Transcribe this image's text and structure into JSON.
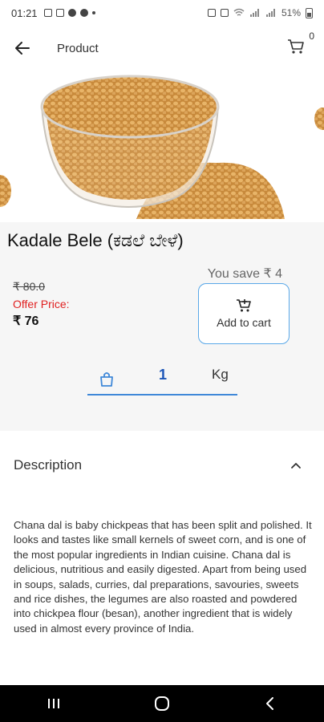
{
  "status_bar": {
    "time": "01:21",
    "battery": "51%"
  },
  "app_bar": {
    "title": "Product",
    "cart_count": "0"
  },
  "product": {
    "name": "Kadale Bele (ಕಡಲೆ ಬೇಳೆ)",
    "mrp": "₹ 80.0",
    "offer_label": "Offer Price:",
    "offer_price": "₹ 76",
    "you_save": "You save ₹ 4",
    "add_to_cart_label": "Add to cart",
    "quantity": "1",
    "unit": "Kg"
  },
  "description": {
    "title": "Description",
    "text": "Chana dal is baby chickpeas that has been split and polished. It looks and tastes like small kernels of sweet corn, and is one of the most popular ingredients in Indian cuisine. Chana dal is delicious, nutritious and easily digested. Apart from being used in soups, salads, curries, dal preparations, savouries, sweets and rice dishes, the legumes are also roasted and powdered into chickpea flour (besan), another ingredient that is widely used in almost every province of India."
  },
  "colors": {
    "accent_blue": "#3f88d8",
    "offer_red": "#e02020",
    "nav_bar": "#000000"
  },
  "icons": [
    "back-arrow-icon",
    "cart-icon",
    "add-cart-icon",
    "shopping-bag-icon",
    "chevron-up-icon",
    "recents-icon",
    "home-icon",
    "back-nav-icon"
  ]
}
